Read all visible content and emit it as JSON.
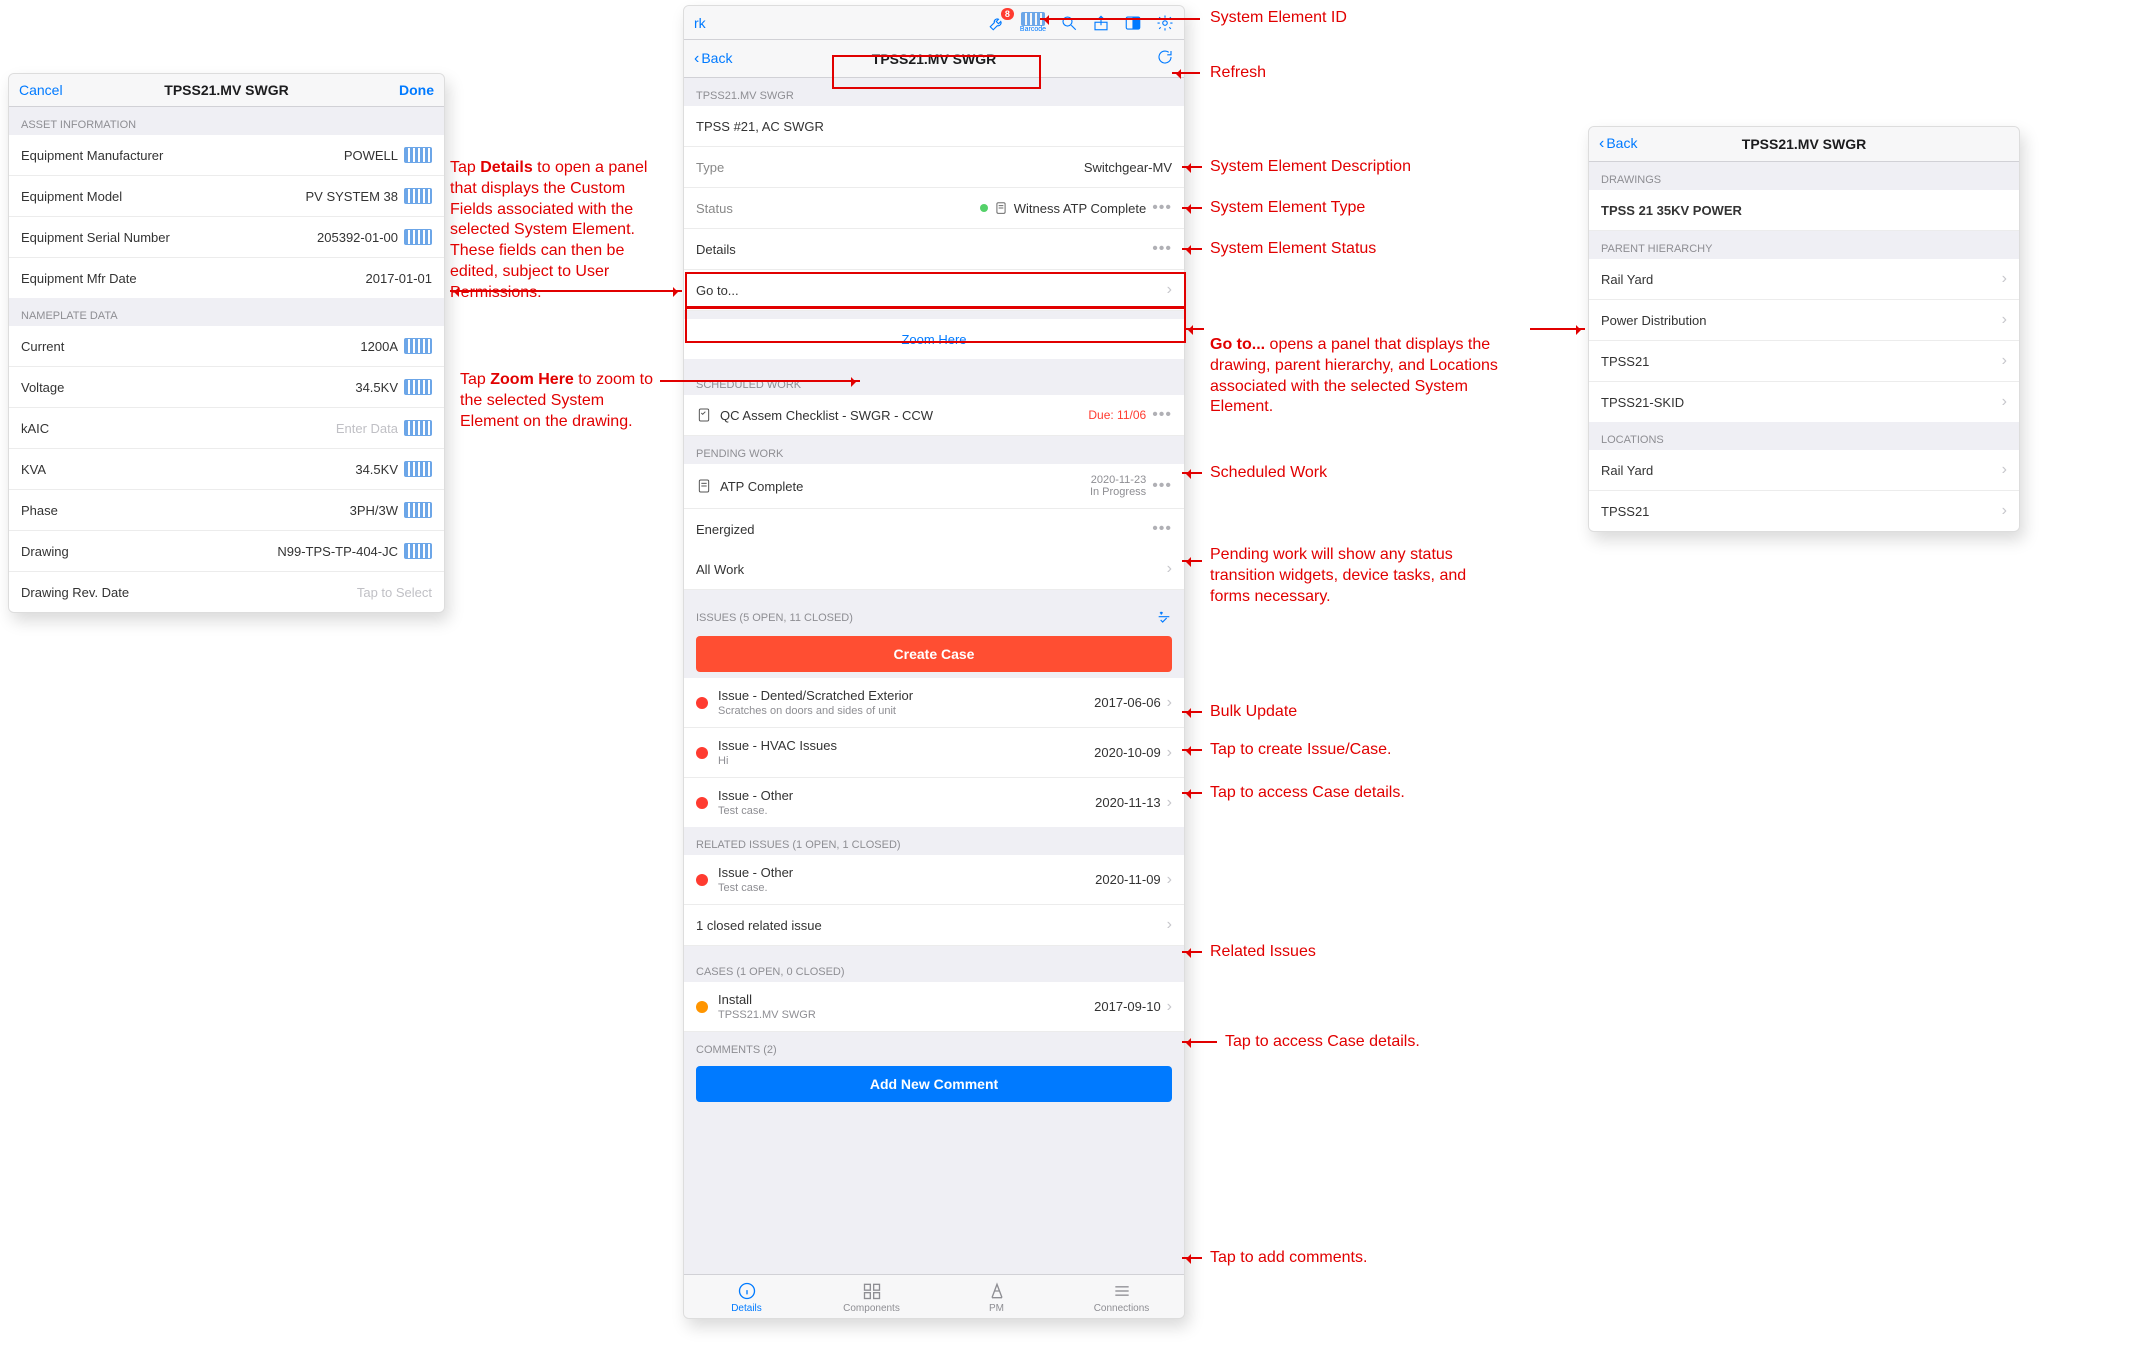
{
  "toolbar": {
    "rk_fragment": "rk",
    "notification_count": "8",
    "barcode_label": "Barcode"
  },
  "details_panel": {
    "cancel": "Cancel",
    "done": "Done",
    "title": "TPSS21.MV SWGR",
    "asset_info_header": "ASSET INFORMATION",
    "nameplate_header": "NAMEPLATE DATA",
    "asset_fields": [
      {
        "label": "Equipment Manufacturer",
        "value": "POWELL",
        "barcode": true
      },
      {
        "label": "Equipment Model",
        "value": "PV SYSTEM 38",
        "barcode": true
      },
      {
        "label": "Equipment Serial Number",
        "value": "205392-01-00",
        "barcode": true
      },
      {
        "label": "Equipment Mfr Date",
        "value": "2017-01-01"
      }
    ],
    "nameplate_fields": [
      {
        "label": "Current",
        "value": "1200A",
        "barcode": true
      },
      {
        "label": "Voltage",
        "value": "34.5KV",
        "barcode": true
      },
      {
        "label": "kAIC",
        "value": "Enter Data",
        "placeholder": true,
        "barcode": true
      },
      {
        "label": "KVA",
        "value": "34.5KV",
        "barcode": true
      },
      {
        "label": "Phase",
        "value": "3PH/3W",
        "barcode": true
      },
      {
        "label": "Drawing",
        "value": "N99-TPS-TP-404-JC",
        "barcode": true
      },
      {
        "label": "Drawing Rev. Date",
        "value": "Tap to Select",
        "placeholder": true
      }
    ]
  },
  "main_panel": {
    "back": "Back",
    "title": "TPSS21.MV SWGR",
    "element_header": "TPSS21.MV SWGR",
    "description": "TPSS #21, AC SWGR",
    "type_label": "Type",
    "type_value": "Switchgear-MV",
    "status_label": "Status",
    "status_value": "Witness ATP Complete",
    "details_label": "Details",
    "goto_label": "Go to...",
    "zoom_here": "Zoom Here",
    "scheduled_header": "SCHEDULED WORK",
    "scheduled_item": "QC Assem Checklist - SWGR - CCW",
    "scheduled_due": "Due: 11/06",
    "pending_header": "PENDING WORK",
    "pending_items": [
      {
        "title": "ATP Complete",
        "meta_line1": "2020-11-23",
        "meta_line2": "In Progress",
        "more": true
      },
      {
        "title": "Energized",
        "more": true
      }
    ],
    "all_work": "All Work",
    "issues_header": "ISSUES (5 OPEN, 11 CLOSED)",
    "create_case": "Create Case",
    "issues": [
      {
        "title": "Issue - Dented/Scratched Exterior",
        "sub": "Scratches on doors and sides of unit",
        "date": "2017-06-06"
      },
      {
        "title": "Issue - HVAC Issues",
        "sub": "Hi",
        "date": "2020-10-09"
      },
      {
        "title": "Issue - Other",
        "sub": "Test case.",
        "date": "2020-11-13"
      }
    ],
    "related_header": "RELATED ISSUES (1 OPEN, 1 CLOSED)",
    "related_issue": {
      "title": "Issue - Other",
      "sub": "Test case.",
      "date": "2020-11-09"
    },
    "closed_related": "1 closed related issue",
    "cases_header": "CASES (1 OPEN, 0 CLOSED)",
    "case_item": {
      "title": "Install",
      "sub": "TPSS21.MV SWGR",
      "date": "2017-09-10"
    },
    "comments_header": "COMMENTS (2)",
    "add_comment": "Add New Comment",
    "tabs": {
      "details": "Details",
      "components": "Components",
      "pm": "PM",
      "connections": "Connections"
    }
  },
  "goto_panel": {
    "back": "Back",
    "title": "TPSS21.MV SWGR",
    "drawings_header": "DRAWINGS",
    "drawing": "TPSS 21 35KV POWER",
    "parent_header": "PARENT HIERARCHY",
    "parents": [
      "Rail Yard",
      "Power Distribution",
      "TPSS21",
      "TPSS21-SKID"
    ],
    "locations_header": "LOCATIONS",
    "locations": [
      "Rail Yard",
      "TPSS21"
    ]
  },
  "annotations": {
    "system_id": "System Element ID",
    "refresh": "Refresh",
    "desc": "System Element Description",
    "type": "System Element Type",
    "status": "System Element Status",
    "details_text": "Tap <b>Details</b> to open a panel that displays the Custom Fields associated with the selected System Element. These fields can then be edited, subject to User Permissions.",
    "zoom_text": "Tap <b>Zoom Here</b> to zoom to the selected System Element on the drawing.",
    "goto_text": "<b>Go to...</b> opens a panel that displays the drawing, parent hierarchy, and Locations associated with the selected System Element.",
    "scheduled": "Scheduled Work",
    "pending": "Pending work will show any status transition widgets, device tasks, and forms necessary.",
    "bulk": "Bulk Update",
    "create_case": "Tap to create Issue/Case.",
    "case_details": "Tap to access Case details.",
    "related": "Related Issues",
    "case_details2": "Tap to access Case details.",
    "comments": "Tap to add comments."
  }
}
